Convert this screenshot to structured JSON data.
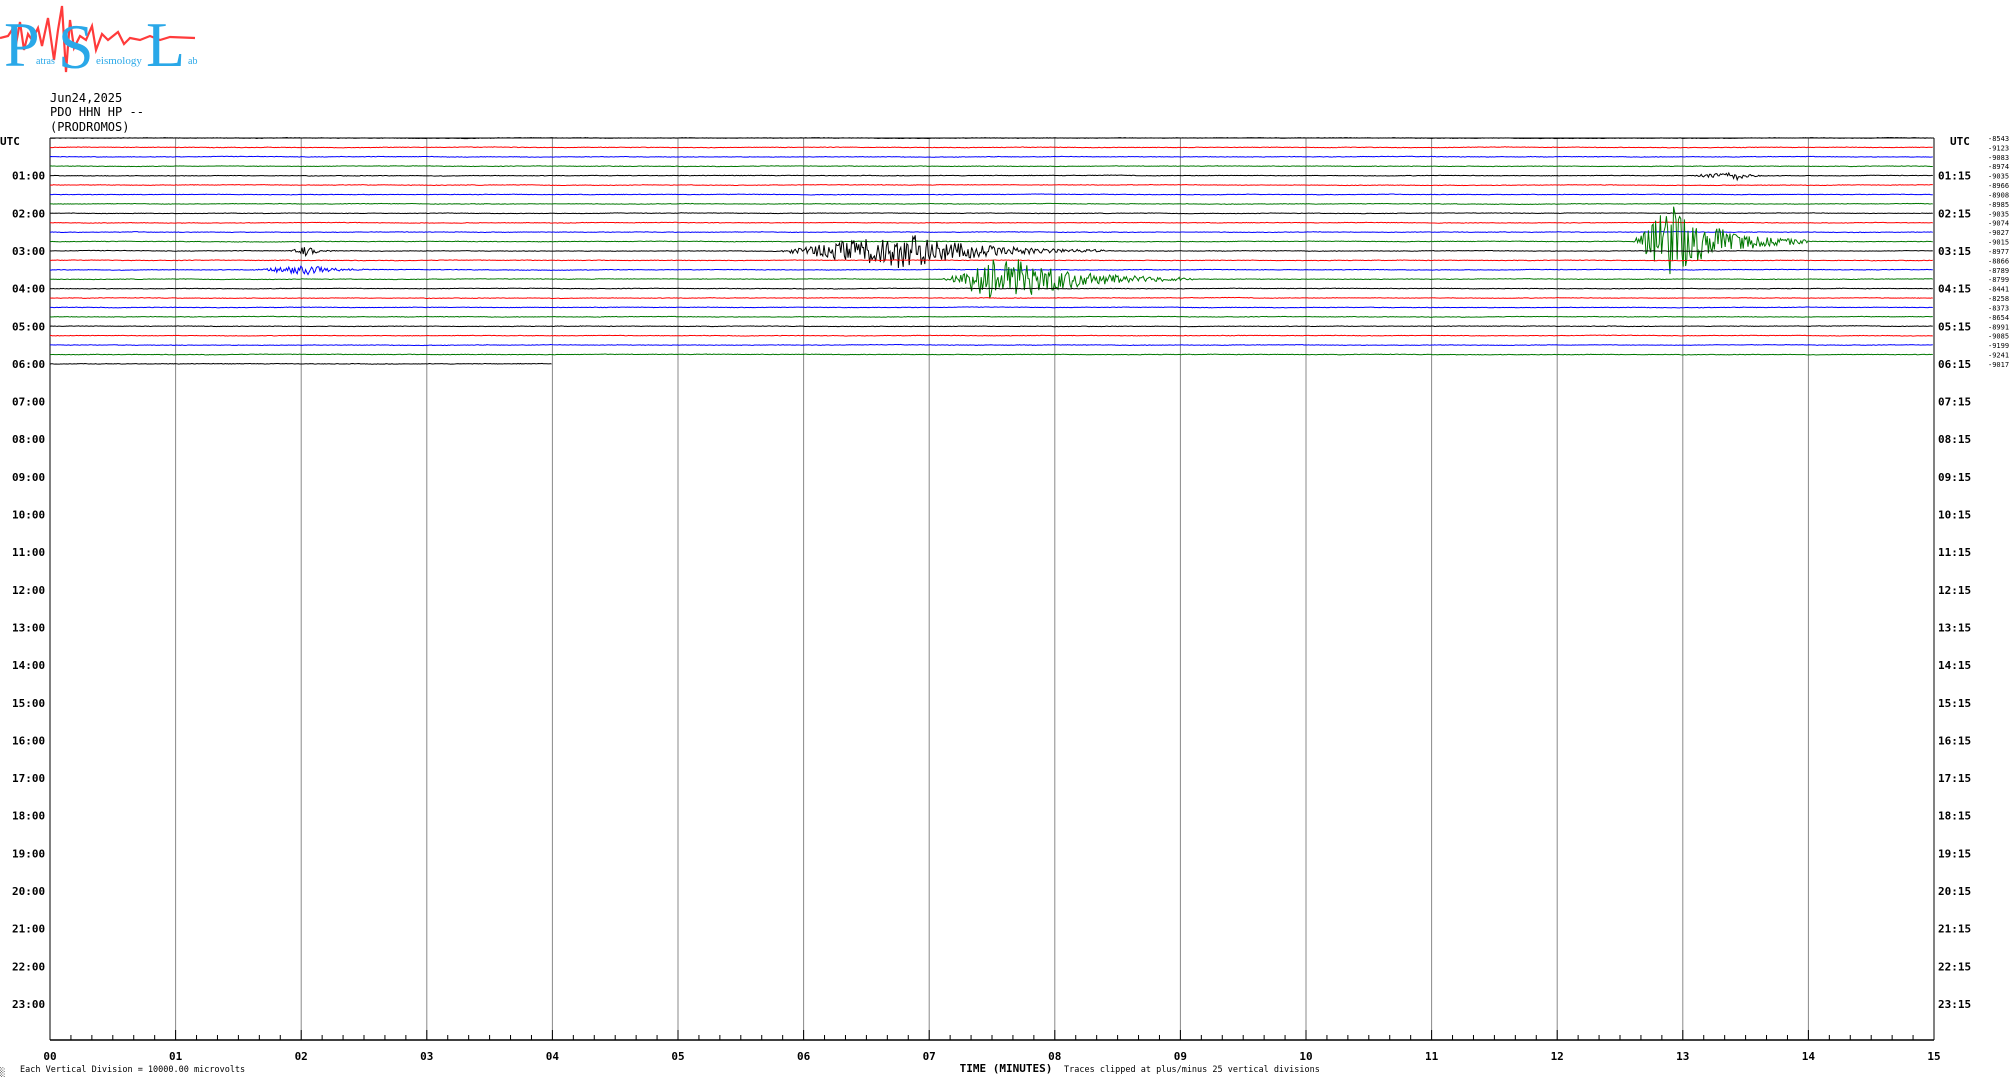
{
  "logo": {
    "letters": [
      "P",
      "S",
      "L"
    ],
    "word1": "atras",
    "word2": "eismology",
    "word3": "ab",
    "colors": {
      "letters": "#2aa8e8",
      "trace": "#ff3b3b"
    }
  },
  "header": {
    "date": "Jun24,2025",
    "station": "PDO HHN HP --",
    "location": "(PRODROMOS)"
  },
  "footer": {
    "scale_note": "Each Vertical Division = 10000.00 microvolts",
    "clip_note": "Traces clipped at plus/minus 25 vertical divisions",
    "corner_mark": "░"
  },
  "chart_data": {
    "type": "line",
    "title": "",
    "xlabel": "TIME (MINUTES)",
    "ylabel": "",
    "xlim": [
      0,
      15
    ],
    "x_ticks": [
      "00",
      "01",
      "02",
      "03",
      "04",
      "05",
      "06",
      "07",
      "08",
      "09",
      "10",
      "11",
      "12",
      "13",
      "14",
      "15"
    ],
    "left_label_title": "UTC",
    "right_label_title": "UTC",
    "left_hour_labels": [
      "01:00",
      "02:00",
      "03:00",
      "04:00",
      "05:00",
      "06:00",
      "07:00",
      "08:00",
      "09:00",
      "10:00",
      "11:00",
      "12:00",
      "13:00",
      "14:00",
      "15:00",
      "16:00",
      "17:00",
      "18:00",
      "19:00",
      "20:00",
      "21:00",
      "22:00",
      "23:00"
    ],
    "right_hour_labels": [
      "01:15",
      "02:15",
      "03:15",
      "04:15",
      "05:15",
      "06:15",
      "07:15",
      "08:15",
      "09:15",
      "10:15",
      "11:15",
      "12:15",
      "13:15",
      "14:15",
      "15:15",
      "16:15",
      "17:15",
      "18:15",
      "19:15",
      "20:15",
      "21:15",
      "22:15",
      "23:15"
    ],
    "rows_per_hour": 4,
    "trace_colors": [
      "#000000",
      "#ff0000",
      "#0000ff",
      "#007700"
    ],
    "trace_offsets": [
      "-8543",
      "-9123",
      "-9083",
      "-8974",
      "-9035",
      "-8966",
      "-8908",
      "-8985",
      "-9035",
      "-9074",
      "-9027",
      "-9015",
      "-8977",
      "-8866",
      "-8789",
      "-8799",
      "-8441",
      "-8258",
      "-8373",
      "-8654",
      "-8991",
      "-9085",
      "-9199",
      "-9241",
      "-9017"
    ],
    "last_trace_end_minute": 4.0,
    "events": [
      {
        "row": 4,
        "minute_start": 13.0,
        "minute_end": 13.7,
        "peak_minute": 13.45,
        "amplitude": 0.5
      },
      {
        "row": 11,
        "minute_start": 12.6,
        "minute_end": 14.0,
        "peak_minute": 12.9,
        "amplitude": 4.5
      },
      {
        "row": 12,
        "minute_start": 1.9,
        "minute_end": 2.3,
        "peak_minute": 2.05,
        "amplitude": 0.6
      },
      {
        "row": 12,
        "minute_start": 5.8,
        "minute_end": 8.4,
        "peak_minute": 6.8,
        "amplitude": 2.2
      },
      {
        "row": 14,
        "minute_start": 1.6,
        "minute_end": 2.6,
        "peak_minute": 2.05,
        "amplitude": 0.6
      },
      {
        "row": 15,
        "minute_start": 7.1,
        "minute_end": 9.1,
        "peak_minute": 7.6,
        "amplitude": 3.0
      },
      {
        "row": 16,
        "minute_start": 0.0,
        "minute_end": 0.0,
        "peak_minute": 0.0,
        "amplitude": 0.0
      }
    ]
  }
}
